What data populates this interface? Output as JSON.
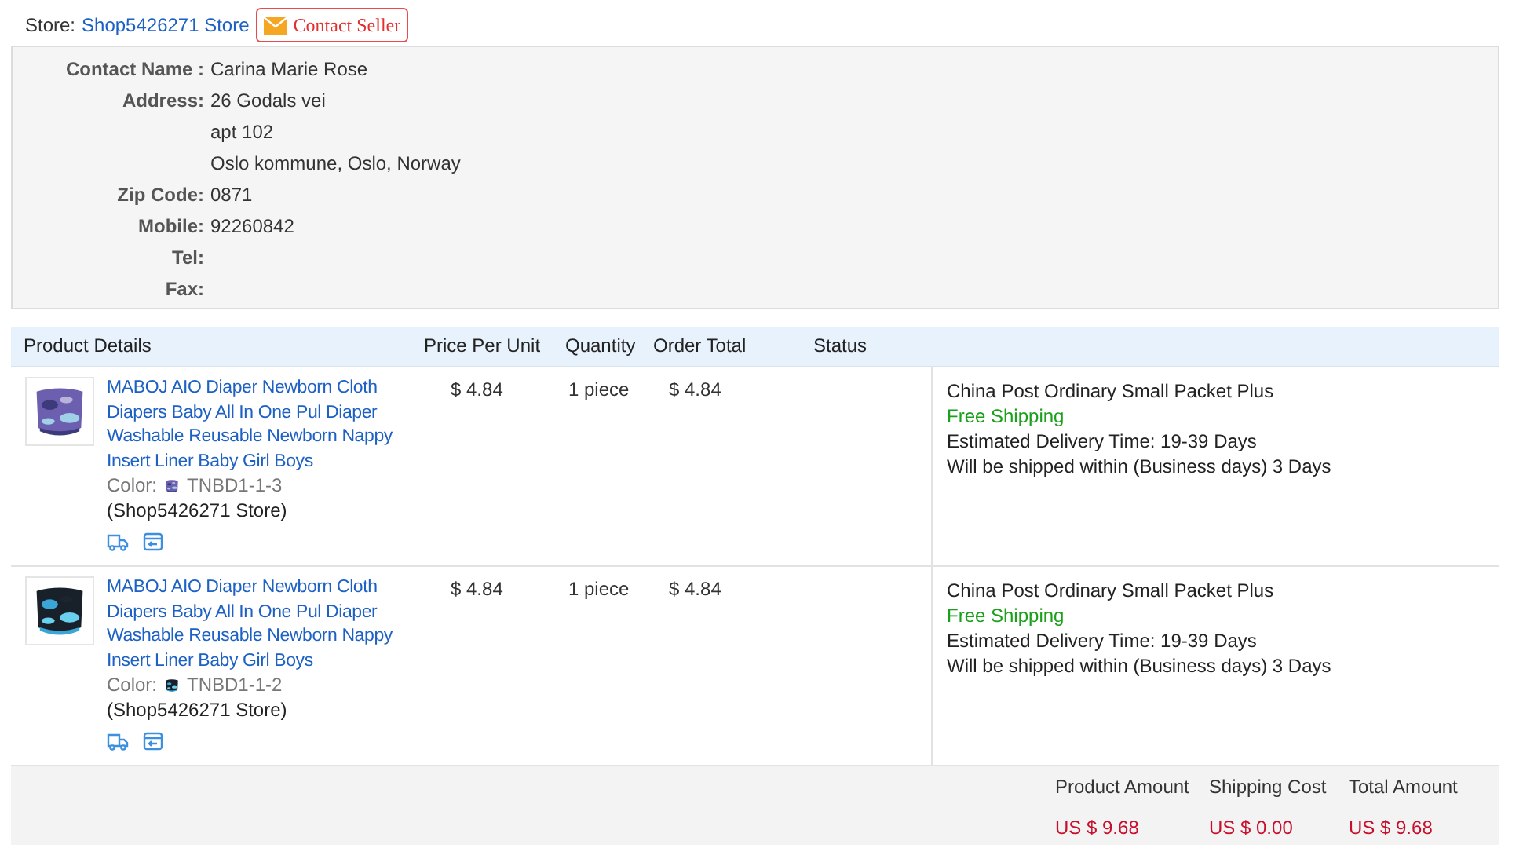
{
  "store": {
    "label": "Store:",
    "name": "Shop5426271 Store",
    "contact_button": "Contact Seller"
  },
  "contact": [
    {
      "label": "Contact Name :",
      "lines": [
        "Carina Marie Rose"
      ]
    },
    {
      "label": "Address:",
      "lines": [
        "26 Godals vei",
        "apt 102",
        "Oslo kommune, Oslo, Norway"
      ]
    },
    {
      "label": "Zip Code:",
      "lines": [
        "0871"
      ]
    },
    {
      "label": "Mobile:",
      "lines": [
        "92260842"
      ]
    },
    {
      "label": "Tel:"
    },
    {
      "label": "Fax:"
    }
  ],
  "columns": [
    "Product Details",
    "Price Per Unit",
    "Quantity",
    "Order Total",
    "Status"
  ],
  "items": [
    {
      "title": "MABOJ AIO Diaper Newborn Cloth Diapers Baby All In One Pul Diaper Washable Reusable Newborn Nappy Insert Liner Baby Girl Boys",
      "color_label": "Color:",
      "color_value": "TNBD1-1-3",
      "store": "(Shop5426271 Store)",
      "price": "$ 4.84",
      "quantity": "1 piece",
      "total": "$ 4.84",
      "shipping": {
        "method": "China Post Ordinary Small Packet Plus",
        "cost": "Free Shipping",
        "delivery": "Estimated Delivery Time:  19-39 Days",
        "ship_within": "Will be shipped within (Business days) 3 Days"
      }
    },
    {
      "title": "MABOJ AIO Diaper Newborn Cloth Diapers Baby All In One Pul Diaper Washable Reusable Newborn Nappy Insert Liner Baby Girl Boys",
      "color_label": "Color:",
      "color_value": "TNBD1-1-2",
      "store": "(Shop5426271 Store)",
      "price": "$ 4.84",
      "quantity": "1 piece",
      "total": "$ 4.84",
      "shipping": {
        "method": "China Post Ordinary Small Packet Plus",
        "cost": "Free Shipping",
        "delivery": "Estimated Delivery Time:  19-39 Days",
        "ship_within": "Will be shipped within (Business days) 3 Days"
      }
    }
  ],
  "totals": [
    {
      "label": "Product Amount",
      "value": "US $ 9.68"
    },
    {
      "label": "Shipping Cost",
      "value": "US $ 0.00"
    },
    {
      "label": "Total Amount",
      "value": "US $ 9.68"
    }
  ]
}
